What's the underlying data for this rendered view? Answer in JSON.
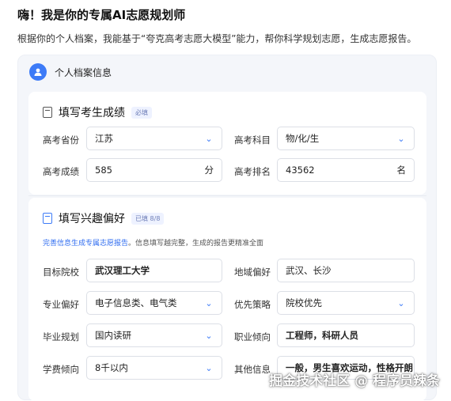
{
  "header": {
    "title": "嗨！我是你的专属AI志愿规划师",
    "subtitle": "根据你的个人档案，我能基于“夸克高考志愿大模型”能力，帮你科学规划志愿，生成志愿报告。"
  },
  "profile": {
    "label": "个人档案信息"
  },
  "scores": {
    "title": "填写考生成绩",
    "badge": "必填",
    "province_label": "高考省份",
    "province_value": "江苏",
    "subjects_label": "高考科目",
    "subjects_value": "物/化/生",
    "score_label": "高考成绩",
    "score_value": "585",
    "score_unit": "分",
    "rank_label": "高考排名",
    "rank_value": "43562",
    "rank_unit": "名"
  },
  "interests": {
    "title": "填写兴趣偏好",
    "badge": "已填 8/8",
    "hint_link": "完善信息生成专属志愿报告",
    "hint_text": "。信息填写越完整，生成的报告更精准全面",
    "target_school_label": "目标院校",
    "target_school_value": "武汉理工大学",
    "region_label": "地域偏好",
    "region_value": "武汉、长沙",
    "major_label": "专业偏好",
    "major_value": "电子信息类、电气类",
    "strategy_label": "优先策略",
    "strategy_value": "院校优先",
    "grad_label": "毕业规划",
    "grad_value": "国内读研",
    "career_label": "职业倾向",
    "career_value": "工程师，科研人员",
    "tuition_label": "学费倾向",
    "tuition_value": "8千以内",
    "other_label": "其他信息",
    "other_value": "一般，男生喜欢运动，性格开朗"
  },
  "watermark": "掘金技术社区 @ 程序员辣条",
  "colors": {
    "accent": "#3d7bf7",
    "link": "#2f6cf0",
    "panel": "#f4f6fa"
  }
}
